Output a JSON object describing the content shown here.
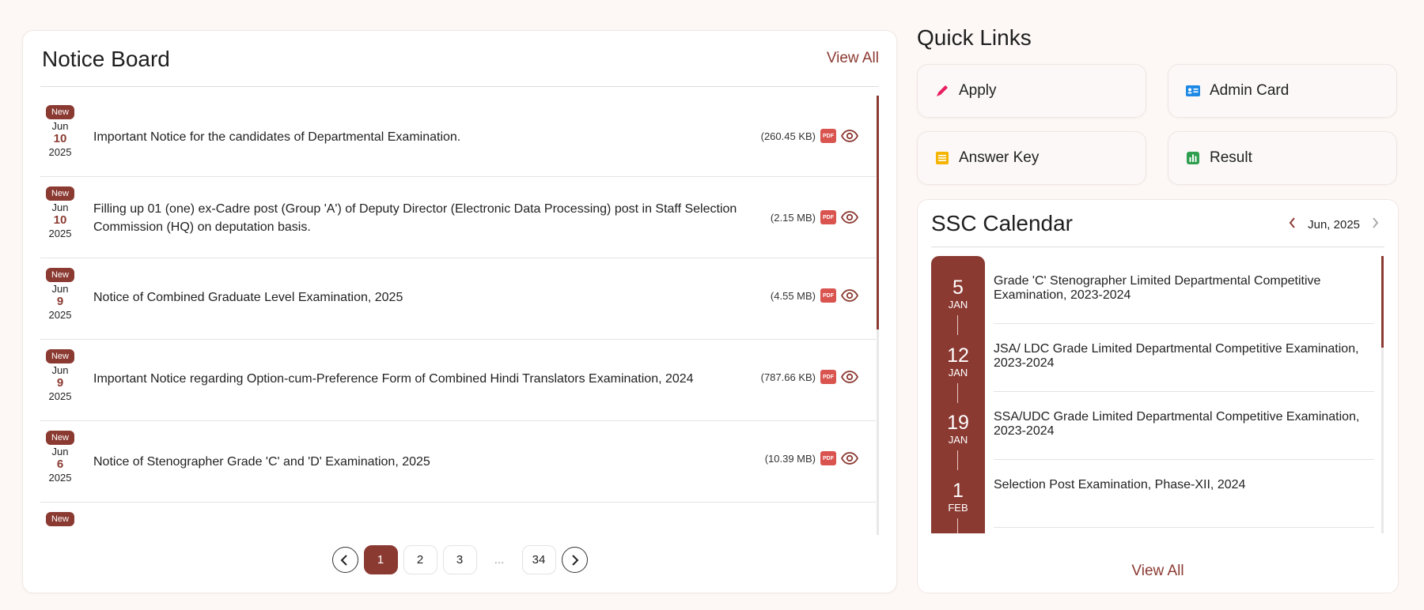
{
  "notice_board": {
    "title": "Notice Board",
    "view_all": "View All",
    "new_label": "New",
    "items": [
      {
        "month": "Jun",
        "day": "10",
        "year": "2025",
        "text": "Important Notice for the candidates of Departmental Examination.",
        "size": "(260.45 KB)"
      },
      {
        "month": "Jun",
        "day": "10",
        "year": "2025",
        "text": "Filling up 01 (one) ex-Cadre post (Group 'A') of Deputy Director (Electronic Data Processing) post in Staff Selection Commission (HQ) on deputation basis.",
        "size": "(2.15 MB)"
      },
      {
        "month": "Jun",
        "day": "9",
        "year": "2025",
        "text": "Notice of Combined Graduate Level Examination, 2025",
        "size": "(4.55 MB)"
      },
      {
        "month": "Jun",
        "day": "9",
        "year": "2025",
        "text": "Important Notice regarding Option-cum-Preference Form of Combined Hindi Translators Examination, 2024",
        "size": "(787.66 KB)"
      },
      {
        "month": "Jun",
        "day": "6",
        "year": "2025",
        "text": "Notice of Stenographer Grade 'C' and 'D' Examination, 2025",
        "size": "(10.39 MB)"
      }
    ],
    "pdf_label": "PDF",
    "pagination": {
      "pages": [
        "1",
        "2",
        "3"
      ],
      "ellipsis": "...",
      "last": "34",
      "current": "1"
    }
  },
  "quick_links": {
    "title": "Quick Links",
    "items": [
      {
        "label": "Apply",
        "icon": "pencil-icon",
        "color": "#e91e63"
      },
      {
        "label": "Admin Card",
        "icon": "id-card-icon",
        "color": "#1e88e5"
      },
      {
        "label": "Answer Key",
        "icon": "list-icon",
        "color": "#f4b400"
      },
      {
        "label": "Result",
        "icon": "bar-chart-icon",
        "color": "#2e9e4f"
      }
    ]
  },
  "calendar": {
    "title": "SSC Calendar",
    "month": "Jun, 2025",
    "view_all": "View All",
    "events": [
      {
        "day": "5",
        "month": "JAN",
        "text": "Grade 'C' Stenographer Limited Departmental Competitive Examination, 2023-2024"
      },
      {
        "day": "12",
        "month": "JAN",
        "text": "JSA/ LDC Grade Limited Departmental Competitive Examination, 2023-2024"
      },
      {
        "day": "19",
        "month": "JAN",
        "text": "SSA/UDC Grade Limited Departmental Competitive Examination, 2023-2024"
      },
      {
        "day": "1",
        "month": "FEB",
        "text": "Selection Post Examination, Phase-XII, 2024"
      }
    ]
  },
  "colors": {
    "accent": "#8b3a32",
    "background": "#fdf8f6"
  }
}
